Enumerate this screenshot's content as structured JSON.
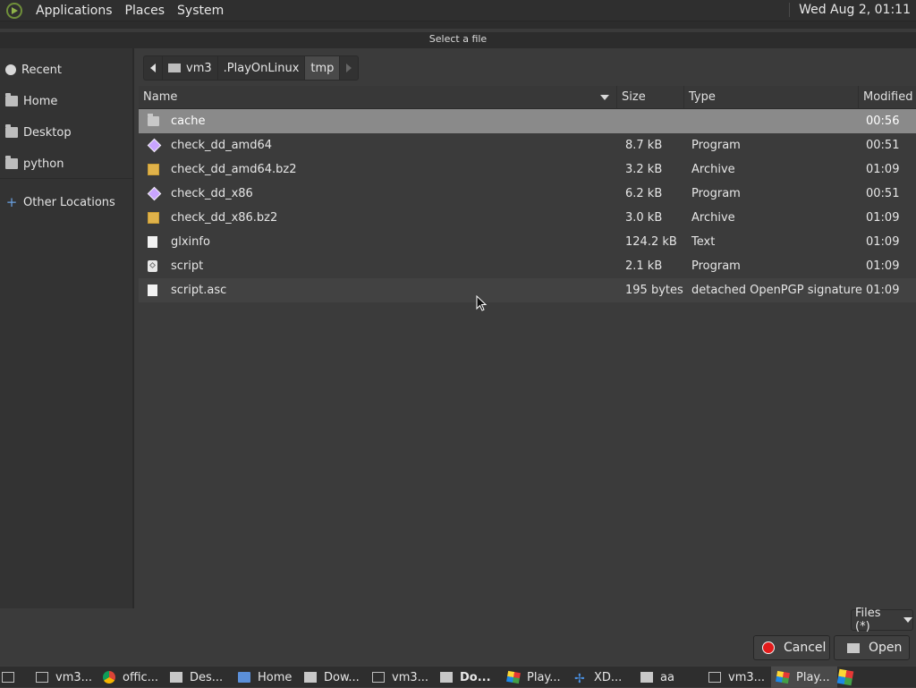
{
  "panel": {
    "menus": [
      "Applications",
      "Places",
      "System"
    ],
    "clock": "Wed Aug  2, 01:11"
  },
  "dialog": {
    "title": "Select a file"
  },
  "sidebar": {
    "items": [
      {
        "label": "Recent",
        "icon": "clock-icon"
      },
      {
        "label": "Home",
        "icon": "home-icon"
      },
      {
        "label": "Desktop",
        "icon": "desktop-icon"
      },
      {
        "label": "python",
        "icon": "folder-icon"
      }
    ],
    "other_locations": "Other Locations"
  },
  "pathbar": {
    "segments": [
      "vm3",
      ".PlayOnLinux",
      "tmp"
    ],
    "active": "tmp"
  },
  "columns": {
    "name": "Name",
    "size": "Size",
    "type": "Type",
    "modified": "Modified"
  },
  "files": [
    {
      "name": "cache",
      "size": "",
      "type": "",
      "modified": "00:56",
      "icon": "folder-icon"
    },
    {
      "name": "check_dd_amd64",
      "size": "8.7 kB",
      "type": "Program",
      "modified": "00:51",
      "icon": "program-icon"
    },
    {
      "name": "check_dd_amd64.bz2",
      "size": "3.2 kB",
      "type": "Archive",
      "modified": "01:09",
      "icon": "archive-icon"
    },
    {
      "name": "check_dd_x86",
      "size": "6.2 kB",
      "type": "Program",
      "modified": "00:51",
      "icon": "program-icon"
    },
    {
      "name": "check_dd_x86.bz2",
      "size": "3.0 kB",
      "type": "Archive",
      "modified": "01:09",
      "icon": "archive-icon"
    },
    {
      "name": "glxinfo",
      "size": "124.2 kB",
      "type": "Text",
      "modified": "01:09",
      "icon": "text-file-icon"
    },
    {
      "name": "script",
      "size": "2.1 kB",
      "type": "Program",
      "modified": "01:09",
      "icon": "script-icon"
    },
    {
      "name": "script.asc",
      "size": "195 bytes",
      "type": "detached OpenPGP signature",
      "modified": "01:09",
      "icon": "text-file-icon"
    }
  ],
  "filter": {
    "label": "Files (*)"
  },
  "buttons": {
    "cancel": "Cancel",
    "open": "Open"
  },
  "taskbar": {
    "items": [
      {
        "label": "vm3...",
        "icon": "terminal-icon"
      },
      {
        "label": "offic...",
        "icon": "chrome-icon"
      },
      {
        "label": "Des...",
        "icon": "folder-icon"
      },
      {
        "label": "Home",
        "icon": "document-icon"
      },
      {
        "label": "Dow...",
        "icon": "folder-icon"
      },
      {
        "label": "vm3...",
        "icon": "terminal-icon"
      },
      {
        "label": "Do...",
        "icon": "folder-icon"
      },
      {
        "label": "Play...",
        "icon": "playonlinux-icon"
      },
      {
        "label": "XD...",
        "icon": "xdialog-icon"
      },
      {
        "label": "aa",
        "icon": "folder-icon"
      },
      {
        "label": "vm3...",
        "icon": "terminal-icon"
      },
      {
        "label": "Play...",
        "icon": "playonlinux-icon"
      }
    ]
  }
}
